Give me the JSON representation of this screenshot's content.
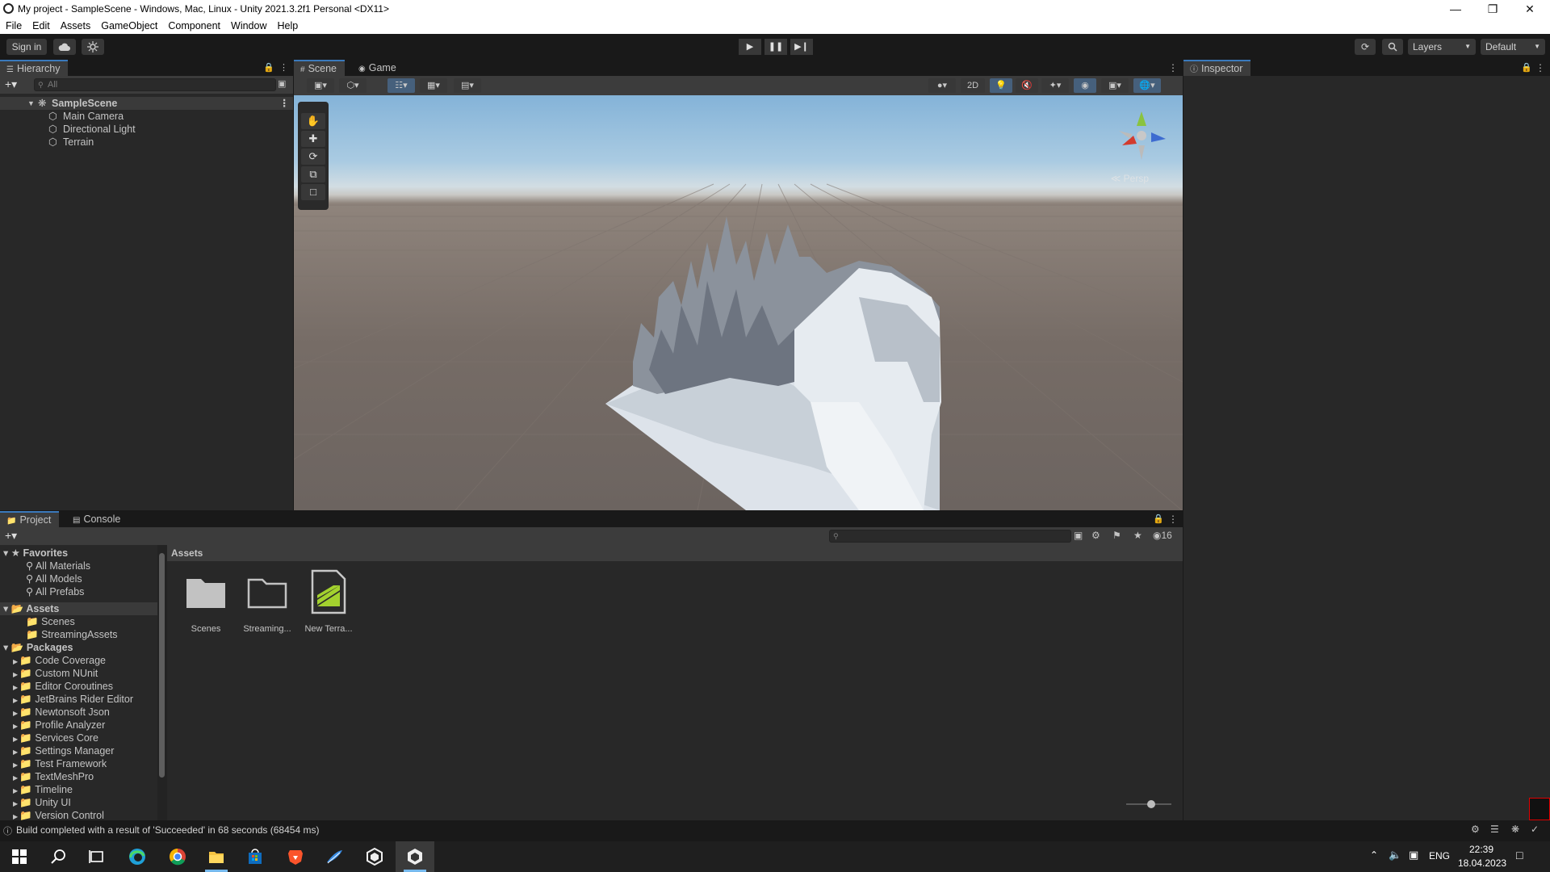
{
  "window": {
    "title": "My project - SampleScene - Windows, Mac, Linux - Unity 2021.3.2f1 Personal <DX11>"
  },
  "menu": [
    "File",
    "Edit",
    "Assets",
    "GameObject",
    "Component",
    "Window",
    "Help"
  ],
  "toolbar": {
    "sign_in": "Sign in",
    "layers": "Layers",
    "layout": "Default"
  },
  "hierarchy": {
    "tab": "Hierarchy",
    "search_placeholder": "All",
    "scene": "SampleScene",
    "objects": [
      "Main Camera",
      "Directional Light",
      "Terrain"
    ]
  },
  "scene_view": {
    "tabs": [
      "Scene",
      "Game"
    ],
    "mode_2d": "2D",
    "persp_label": "Persp"
  },
  "inspector": {
    "tab": "Inspector"
  },
  "project": {
    "tabs": [
      "Project",
      "Console"
    ],
    "hidden_count": "16",
    "breadcrumb": "Assets",
    "favorites_label": "Favorites",
    "favorites": [
      "All Materials",
      "All Models",
      "All Prefabs"
    ],
    "assets_label": "Assets",
    "assets_children": [
      "Scenes",
      "StreamingAssets"
    ],
    "packages_label": "Packages",
    "packages": [
      "Code Coverage",
      "Custom NUnit",
      "Editor Coroutines",
      "JetBrains Rider Editor",
      "Newtonsoft Json",
      "Profile Analyzer",
      "Services Core",
      "Settings Manager",
      "Test Framework",
      "TextMeshPro",
      "Timeline",
      "Unity UI",
      "Version Control"
    ],
    "items": [
      {
        "label": "Scenes",
        "icon": "folder-filled-icon"
      },
      {
        "label": "Streaming...",
        "icon": "folder-outline-icon"
      },
      {
        "label": "New Terra...",
        "icon": "terrain-asset-icon"
      }
    ]
  },
  "status": {
    "message": "Build completed with a result of 'Succeeded' in 68 seconds (68454 ms)"
  },
  "taskbar": {
    "language": "ENG",
    "time": "22:39",
    "date": "18.04.2023"
  },
  "colors": {
    "accent": "#3a79bb",
    "panel_bg": "#282828",
    "toolbar_bg": "#3c3c3c",
    "terrain_green": "#a3d12e"
  }
}
